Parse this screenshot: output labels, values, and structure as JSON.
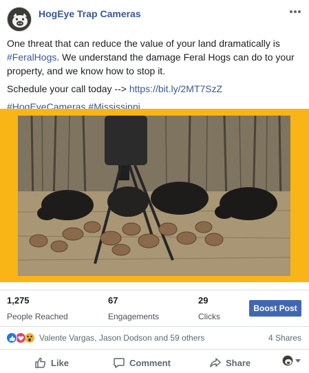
{
  "page": {
    "name": "HogEye Trap Cameras"
  },
  "post": {
    "line1": "One threat that can reduce the value of your land dramatically is",
    "hashtag_feral": "#FeralHogs",
    "line2_rest": ". We understand the damage Feral Hogs can do to your property, and we know how to stop it.",
    "schedule_text": "Schedule your call today --> ",
    "schedule_link": "https://bit.ly/2MT7SzZ",
    "hashtag1": "#HogEyeCameras",
    "hashtag2": "#Mississippi"
  },
  "media": {
    "background_color": "#f8b515",
    "subject": "feral hogs and piglets feeding beneath a hanging feeder in a wooded clearing"
  },
  "stats": {
    "reached_value": "1,275",
    "reached_label": "People Reached",
    "engagements_value": "67",
    "engagements_label": "Engagements",
    "clicks_value": "29",
    "clicks_label": "Clicks",
    "boost_label": "Boost Post"
  },
  "reactions": {
    "icons": [
      "like-icon",
      "love-icon",
      "wow-icon"
    ],
    "names": "Valente Vargas, Jason Dodson and 59 others",
    "shares": "4 Shares"
  },
  "actions": {
    "like": "Like",
    "comment": "Comment",
    "share": "Share"
  },
  "colors": {
    "link": "#385898",
    "boost": "#4267b2",
    "like_blue": "#1877f2",
    "love_red": "#f33e58",
    "wow_yellow": "#f7b125"
  }
}
